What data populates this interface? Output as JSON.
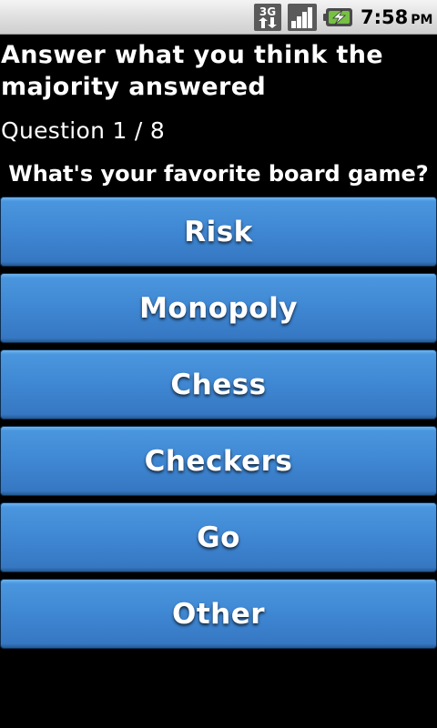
{
  "status_bar": {
    "network_type": "3G",
    "time": "7:58",
    "ampm": "PM",
    "icons": [
      "3g-data-icon",
      "signal-strength-icon",
      "battery-charging-icon"
    ]
  },
  "quiz": {
    "instruction": "Answer what you think the majority answered",
    "counter": "Question 1 / 8",
    "question": "What's your favorite board game?",
    "answers": [
      "Risk",
      "Monopoly",
      "Chess",
      "Checkers",
      "Go",
      "Other"
    ]
  },
  "colors": {
    "background": "#000000",
    "button_blue": "#3f87d3",
    "text": "#ffffff"
  }
}
